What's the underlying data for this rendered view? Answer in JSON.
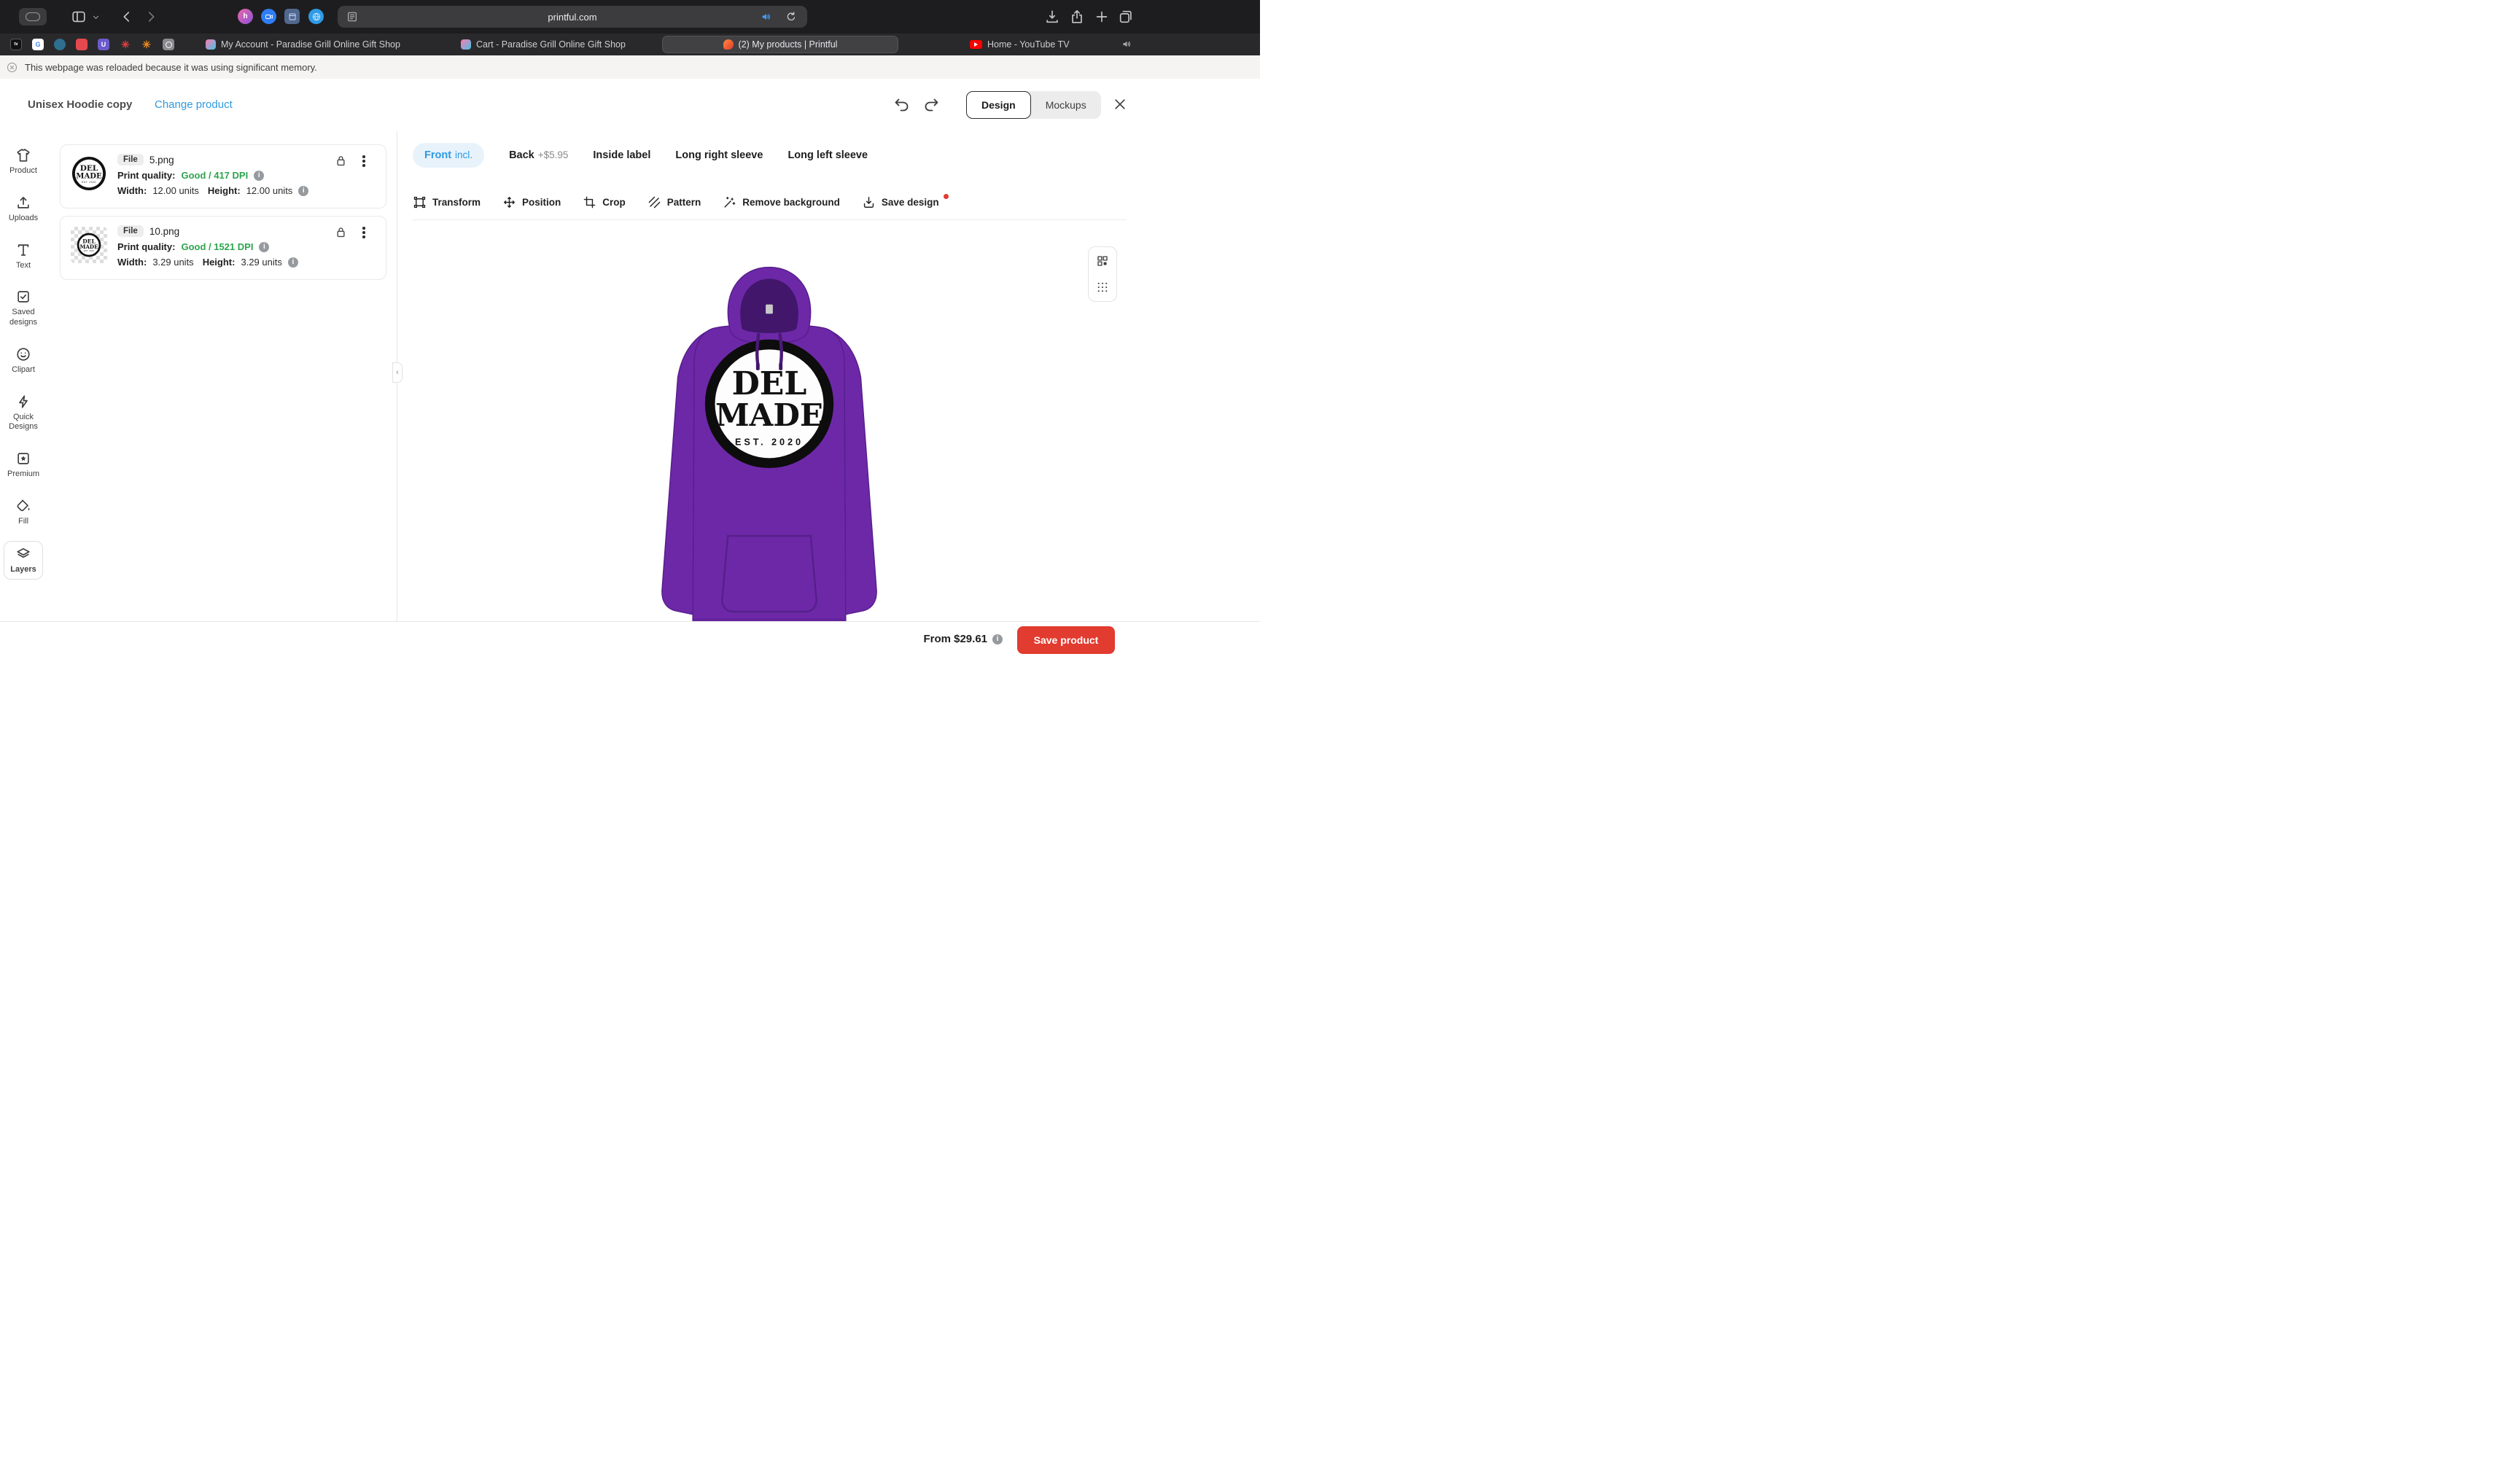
{
  "browser": {
    "url": "printful.com",
    "tabs": [
      {
        "label": "My Account - Paradise Grill Online Gift Shop"
      },
      {
        "label": "Cart - Paradise Grill Online Gift Shop"
      },
      {
        "label": "(2) My products | Printful"
      },
      {
        "label": "Home - YouTube TV"
      }
    ],
    "notification": "This webpage was reloaded because it was using significant memory."
  },
  "header": {
    "product_name": "Unisex Hoodie copy",
    "change_product_label": "Change product",
    "design_label": "Design",
    "mockups_label": "Mockups"
  },
  "sidebar": {
    "items": [
      {
        "label": "Product"
      },
      {
        "label": "Uploads"
      },
      {
        "label": "Text"
      },
      {
        "label": "Saved designs"
      },
      {
        "label": "Clipart"
      },
      {
        "label": "Quick Designs"
      },
      {
        "label": "Premium"
      },
      {
        "label": "Fill"
      },
      {
        "label": "Layers"
      }
    ]
  },
  "layers": {
    "items": [
      {
        "badge": "File",
        "filename": "5.png",
        "quality_label": "Print quality:",
        "quality_value": "Good / 417 DPI",
        "width_label": "Width:",
        "width_value": "12.00 units",
        "height_label": "Height:",
        "height_value": "12.00 units"
      },
      {
        "badge": "File",
        "filename": "10.png",
        "quality_label": "Print quality:",
        "quality_value": "Good / 1521 DPI",
        "width_label": "Width:",
        "width_value": "3.29 units",
        "height_label": "Height:",
        "height_value": "3.29 units"
      }
    ]
  },
  "placements": {
    "items": [
      {
        "label": "Front",
        "suffix": "incl."
      },
      {
        "label": "Back",
        "suffix": "+$5.95"
      },
      {
        "label": "Inside label",
        "suffix": ""
      },
      {
        "label": "Long right sleeve",
        "suffix": ""
      },
      {
        "label": "Long left sleeve",
        "suffix": ""
      }
    ]
  },
  "tools": {
    "items": [
      {
        "label": "Transform"
      },
      {
        "label": "Position"
      },
      {
        "label": "Crop"
      },
      {
        "label": "Pattern"
      },
      {
        "label": "Remove background"
      },
      {
        "label": "Save design"
      }
    ]
  },
  "design": {
    "logo_line1": "DEL",
    "logo_line2": "MADE",
    "logo_line3": "EST. 2020"
  },
  "footer": {
    "price": "From $29.61",
    "save_label": "Save product"
  },
  "colors": {
    "accent_blue": "#2f9ae0",
    "quality_green": "#2da44e",
    "save_red": "#e23b30",
    "hoodie_purple": "#6d28a8"
  }
}
